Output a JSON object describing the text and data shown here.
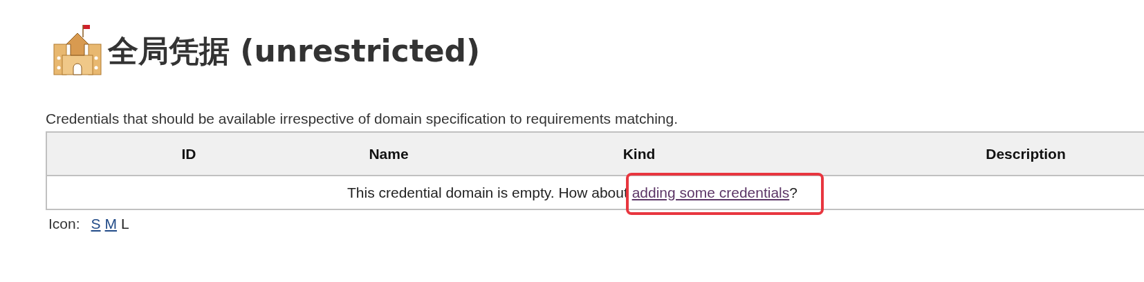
{
  "heading": {
    "title": "全局凭据 (unrestricted)"
  },
  "description": "Credentials that should be available irrespective of domain specification to requirements matching.",
  "table": {
    "columns": [
      "ID",
      "Name",
      "Kind",
      "Description"
    ],
    "empty_message": {
      "text": "This credential domain is empty. How about ",
      "link": "adding some credentials",
      "suffix": "?",
      "highlighted": true
    }
  },
  "icon_sizes": {
    "label": "Icon:",
    "options": [
      {
        "label": "S",
        "selected": false
      },
      {
        "label": "M",
        "selected": false
      },
      {
        "label": "L",
        "selected": true
      }
    ]
  }
}
